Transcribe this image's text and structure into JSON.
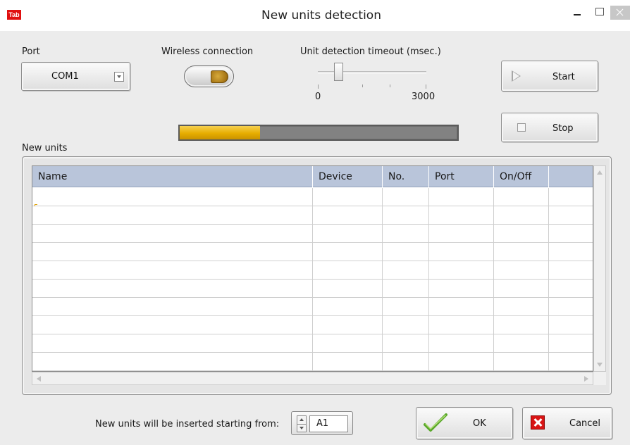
{
  "window": {
    "title": "New units detection",
    "icon_label": "Tab",
    "icons": [
      "minimize-icon",
      "maximize-icon",
      "close-icon"
    ]
  },
  "port": {
    "label": "Port",
    "selected": "COM1"
  },
  "wireless": {
    "label": "Wireless connection",
    "state": "on"
  },
  "timeout": {
    "label": "Unit detection timeout (msec.)",
    "min_label": "0",
    "max_label": "3000",
    "min": 0,
    "max": 3000,
    "value": 500
  },
  "actions": {
    "start_label": "Start",
    "stop_label": "Stop"
  },
  "progress": {
    "fraction": 0.29,
    "fill_color": "#e6ad00"
  },
  "new_units": {
    "label": "New units",
    "columns": [
      "Name",
      "Device",
      "No.",
      "Port",
      "On/Off",
      ""
    ],
    "rows": []
  },
  "insert": {
    "label": "New units will be inserted starting from:",
    "value": "A1"
  },
  "footer": {
    "ok_label": "OK",
    "cancel_label": "Cancel"
  },
  "colors": {
    "header_bg": "#b9c5da",
    "accent_gold": "#d6a020"
  }
}
